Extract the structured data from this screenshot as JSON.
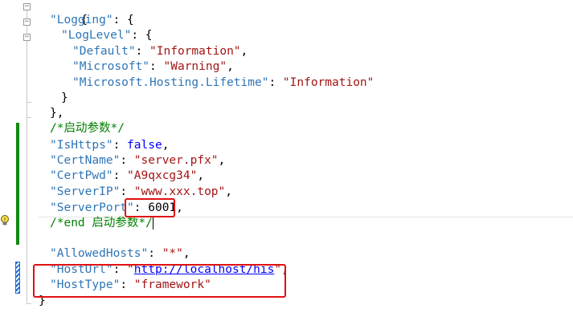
{
  "editor": {
    "lines": [
      {
        "brace": "{"
      },
      {
        "key": "\"Logging\"",
        "colon": ": ",
        "tail": "{"
      },
      {
        "key": "\"LogLevel\"",
        "colon": ": ",
        "tail": "{"
      },
      {
        "key": "\"Default\"",
        "colon": ": ",
        "value": "\"Information\"",
        "tail": ","
      },
      {
        "key": "\"Microsoft\"",
        "colon": ": ",
        "value": "\"Warning\"",
        "tail": ","
      },
      {
        "key": "\"Microsoft.Hosting.Lifetime\"",
        "colon": ": ",
        "value": "\"Information\""
      },
      {
        "brace": "}"
      },
      {
        "brace": "},"
      },
      {
        "comment": "/*启动参数*/"
      },
      {
        "key": "\"IsHttps\"",
        "colon": ": ",
        "literal": "false",
        "tail": ","
      },
      {
        "key": "\"CertName\"",
        "colon": ": ",
        "value": "\"server.pfx\"",
        "tail": ","
      },
      {
        "key": "\"CertPwd\"",
        "colon": ": ",
        "value": "\"A9qxcg34\"",
        "tail": ","
      },
      {
        "key": "\"ServerIP\"",
        "colon": ": ",
        "value": "\"www.xxx.top\"",
        "tail": ","
      },
      {
        "key": "\"ServerPort\"",
        "colon": ": ",
        "literal": "6001",
        "tail": ","
      },
      {
        "comment": "/*end 启动参数*/"
      },
      {
        "key": "\"AllowedHosts\"",
        "colon": ": ",
        "value": "\"*\"",
        "tail": ","
      },
      {
        "key": "\"HostUrl\"",
        "colon": ": ",
        "q1": "\"",
        "url": "http://localhost/his",
        "q2": "\"",
        "tail": ","
      },
      {
        "key": "\"HostType\"",
        "colon": ": ",
        "value": "\"framework\""
      },
      {
        "brace": "}"
      }
    ]
  },
  "colors": {
    "key": "#2e75b6",
    "string": "#a31515",
    "keyword": "#0000ff",
    "comment": "#008000",
    "highlight_box": "#e01010",
    "change_bar": "#108a10"
  },
  "icons": [
    "fold-collapse-icon",
    "lightbulb-icon"
  ]
}
